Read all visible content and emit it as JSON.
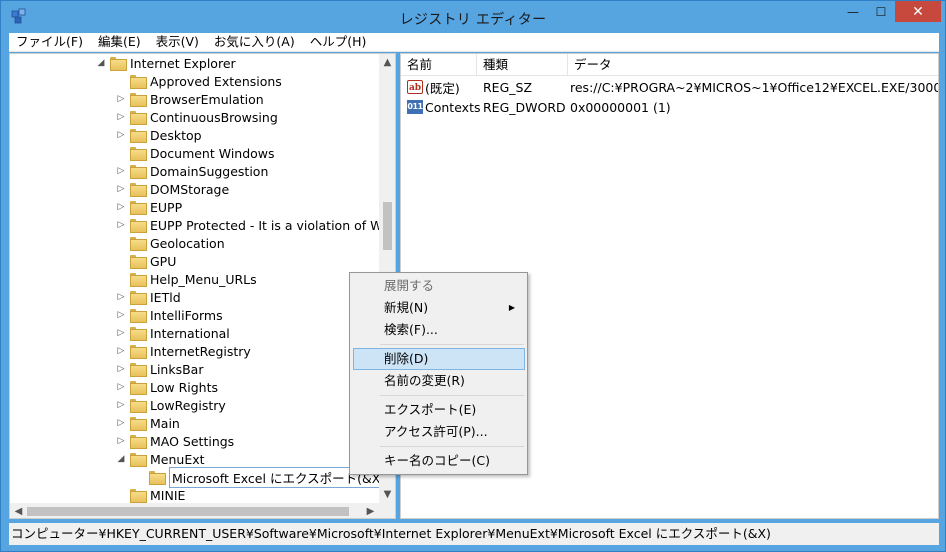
{
  "window": {
    "title": "レジストリ エディター",
    "controls": {
      "minimize": "—",
      "maximize": "☐",
      "close": "✕"
    }
  },
  "menubar": [
    "ファイル(F)",
    "編集(E)",
    "表示(V)",
    "お気に入り(A)",
    "ヘルプ(H)"
  ],
  "tree": {
    "items": [
      {
        "label": "Internet Explorer",
        "expander": "◢",
        "indent": 0
      },
      {
        "label": "Approved Extensions",
        "expander": "",
        "indent": 1
      },
      {
        "label": "BrowserEmulation",
        "expander": "▷",
        "indent": 1
      },
      {
        "label": "ContinuousBrowsing",
        "expander": "▷",
        "indent": 1
      },
      {
        "label": "Desktop",
        "expander": "▷",
        "indent": 1
      },
      {
        "label": "Document Windows",
        "expander": "",
        "indent": 1
      },
      {
        "label": "DomainSuggestion",
        "expander": "▷",
        "indent": 1
      },
      {
        "label": "DOMStorage",
        "expander": "▷",
        "indent": 1
      },
      {
        "label": "EUPP",
        "expander": "▷",
        "indent": 1
      },
      {
        "label": "EUPP Protected - It is a violation of Win",
        "expander": "▷",
        "indent": 1
      },
      {
        "label": "Geolocation",
        "expander": "",
        "indent": 1
      },
      {
        "label": "GPU",
        "expander": "",
        "indent": 1
      },
      {
        "label": "Help_Menu_URLs",
        "expander": "",
        "indent": 1
      },
      {
        "label": "IETld",
        "expander": "▷",
        "indent": 1
      },
      {
        "label": "IntelliForms",
        "expander": "▷",
        "indent": 1
      },
      {
        "label": "International",
        "expander": "▷",
        "indent": 1
      },
      {
        "label": "InternetRegistry",
        "expander": "▷",
        "indent": 1
      },
      {
        "label": "LinksBar",
        "expander": "▷",
        "indent": 1
      },
      {
        "label": "Low Rights",
        "expander": "▷",
        "indent": 1
      },
      {
        "label": "LowRegistry",
        "expander": "▷",
        "indent": 1
      },
      {
        "label": "Main",
        "expander": "▷",
        "indent": 1
      },
      {
        "label": "MAO Settings",
        "expander": "▷",
        "indent": 1
      },
      {
        "label": "MenuExt",
        "expander": "◢",
        "indent": 1
      },
      {
        "label": "Microsoft Excel にエクスポート(&X)",
        "expander": "",
        "indent": 2,
        "selected": true
      },
      {
        "label": "MINIE",
        "expander": "",
        "indent": 1
      }
    ]
  },
  "list": {
    "columns": [
      "名前",
      "種類",
      "データ"
    ],
    "rows": [
      {
        "name": "(既定)",
        "type": "REG_SZ",
        "data": "res://C:¥PROGRA~2¥MICROS~1¥Office12¥EXCEL.EXE/3000",
        "icon": "ab"
      },
      {
        "name": "Contexts",
        "type": "REG_DWORD",
        "data": "0x00000001 (1)",
        "icon": "011"
      }
    ]
  },
  "context_menu": {
    "items": [
      {
        "label": "展開する",
        "disabled": true
      },
      {
        "label": "新規(N)",
        "submenu": true
      },
      {
        "label": "検索(F)..."
      },
      {
        "separator": true
      },
      {
        "label": "削除(D)",
        "hover": true
      },
      {
        "label": "名前の変更(R)"
      },
      {
        "separator": true
      },
      {
        "label": "エクスポート(E)"
      },
      {
        "label": "アクセス許可(P)..."
      },
      {
        "separator": true
      },
      {
        "label": "キー名のコピー(C)"
      }
    ]
  },
  "statusbar": {
    "path": "コンピューター¥HKEY_CURRENT_USER¥Software¥Microsoft¥Internet Explorer¥MenuExt¥Microsoft Excel にエクスポート(&X)"
  }
}
